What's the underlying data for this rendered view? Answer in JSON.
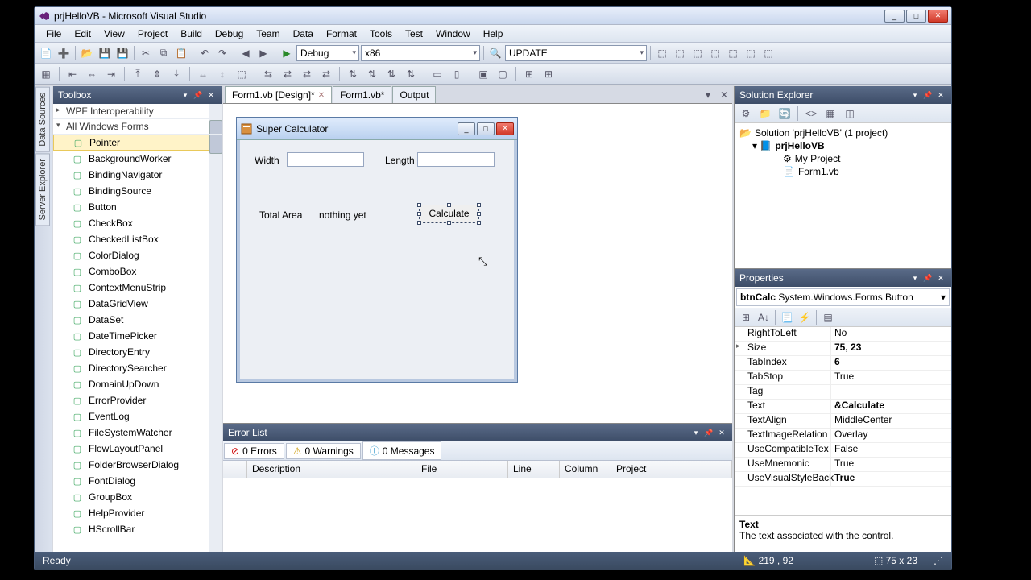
{
  "window": {
    "title": "prjHelloVB - Microsoft Visual Studio"
  },
  "menu": [
    "File",
    "Edit",
    "View",
    "Project",
    "Build",
    "Debug",
    "Team",
    "Data",
    "Format",
    "Tools",
    "Test",
    "Window",
    "Help"
  ],
  "toolbar": {
    "config": "Debug",
    "platform": "x86",
    "extra": "UPDATE"
  },
  "leftEdge": [
    "Data Sources",
    "Server Explorer"
  ],
  "toolbox": {
    "title": "Toolbox",
    "groups": [
      {
        "label": "WPF Interoperability",
        "open": false
      },
      {
        "label": "All Windows Forms",
        "open": true
      }
    ],
    "selected": "Pointer",
    "items": [
      "Pointer",
      "BackgroundWorker",
      "BindingNavigator",
      "BindingSource",
      "Button",
      "CheckBox",
      "CheckedListBox",
      "ColorDialog",
      "ComboBox",
      "ContextMenuStrip",
      "DataGridView",
      "DataSet",
      "DateTimePicker",
      "DirectoryEntry",
      "DirectorySearcher",
      "DomainUpDown",
      "ErrorProvider",
      "EventLog",
      "FileSystemWatcher",
      "FlowLayoutPanel",
      "FolderBrowserDialog",
      "FontDialog",
      "GroupBox",
      "HelpProvider",
      "HScrollBar"
    ]
  },
  "docTabs": [
    {
      "label": "Form1.vb [Design]*",
      "active": true,
      "closable": true
    },
    {
      "label": "Form1.vb*",
      "active": false,
      "closable": false
    },
    {
      "label": "Output",
      "active": false,
      "closable": false
    }
  ],
  "form": {
    "title": "Super Calculator",
    "widthLabel": "Width",
    "lengthLabel": "Length",
    "totalAreaLabel": "Total Area",
    "resultText": "nothing yet",
    "buttonText": "Calculate"
  },
  "errorList": {
    "title": "Error List",
    "tabs": {
      "errors": "0 Errors",
      "warnings": "0 Warnings",
      "messages": "0 Messages"
    },
    "columns": [
      "",
      "Description",
      "File",
      "Line",
      "Column",
      "Project"
    ]
  },
  "solution": {
    "title": "Solution Explorer",
    "root": "Solution 'prjHelloVB' (1 project)",
    "project": "prjHelloVB",
    "items": [
      "My Project",
      "Form1.vb"
    ]
  },
  "properties": {
    "title": "Properties",
    "selector": {
      "name": "btnCalc",
      "type": "System.Windows.Forms.Button"
    },
    "rows": [
      {
        "name": "RightToLeft",
        "value": "No"
      },
      {
        "name": "Size",
        "value": "75, 23",
        "bold": true,
        "expand": true
      },
      {
        "name": "TabIndex",
        "value": "6",
        "bold": true
      },
      {
        "name": "TabStop",
        "value": "True"
      },
      {
        "name": "Tag",
        "value": ""
      },
      {
        "name": "Text",
        "value": "&Calculate",
        "bold": true
      },
      {
        "name": "TextAlign",
        "value": "MiddleCenter"
      },
      {
        "name": "TextImageRelation",
        "value": "Overlay"
      },
      {
        "name": "UseCompatibleTex",
        "value": "False"
      },
      {
        "name": "UseMnemonic",
        "value": "True"
      },
      {
        "name": "UseVisualStyleBack",
        "value": "True",
        "bold": true
      }
    ],
    "desc": {
      "name": "Text",
      "text": "The text associated with the control."
    }
  },
  "status": {
    "left": "Ready",
    "pos": "219 , 92",
    "size": "75 x 23"
  }
}
